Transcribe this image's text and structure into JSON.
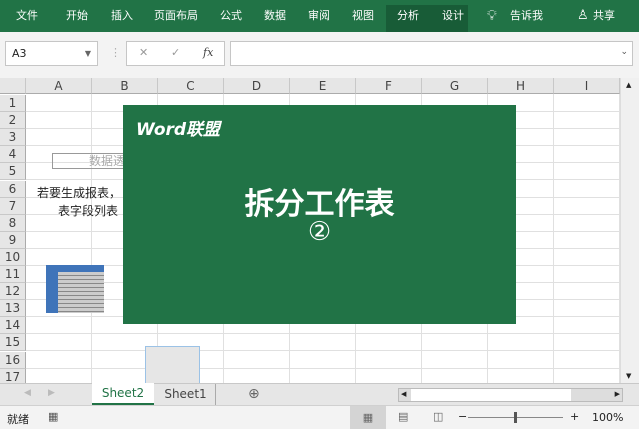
{
  "ribbon": {
    "tabs": [
      "文件",
      "开始",
      "插入",
      "页面布局",
      "公式",
      "数据",
      "审阅",
      "视图",
      "分析",
      "设计"
    ],
    "tell_me": "告诉我",
    "share": "共享"
  },
  "formula_bar": {
    "name_box": "A3",
    "fx": "fx",
    "formula": ""
  },
  "grid": {
    "columns": [
      "A",
      "B",
      "C",
      "D",
      "E",
      "F",
      "G",
      "H",
      "I"
    ],
    "rows": [
      "1",
      "2",
      "3",
      "4",
      "5",
      "6",
      "7",
      "8",
      "9",
      "10",
      "11",
      "12",
      "13",
      "14",
      "15",
      "16",
      "17"
    ],
    "pivot_title": "数据透",
    "pivot_hint_line1": "若要生成报表，",
    "pivot_hint_line2": "表字段列表"
  },
  "overlay": {
    "logo": "Word联盟",
    "title": "拆分工作表",
    "number": "②",
    "color": "#217346"
  },
  "sheets": {
    "tabs": [
      "Sheet2",
      "Sheet1"
    ],
    "active": "Sheet2"
  },
  "status": {
    "ready": "就绪",
    "zoom": "100%",
    "zoom_minus": "−",
    "zoom_plus": "+"
  }
}
